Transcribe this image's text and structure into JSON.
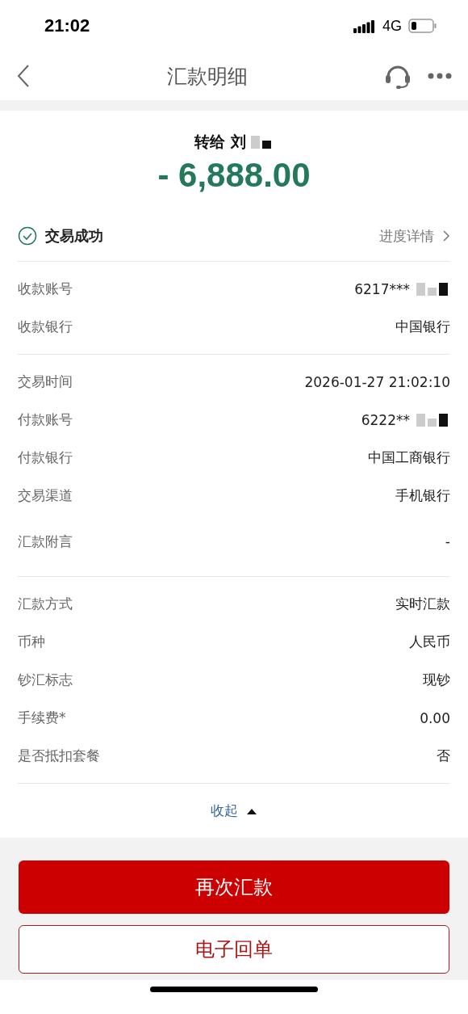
{
  "status_bar": {
    "time": "21:02",
    "network": "4G"
  },
  "nav": {
    "title": "汇款明细"
  },
  "summary": {
    "payee_prefix": "转给",
    "payee_name": "刘",
    "payee_masked": true,
    "amount": "- 6,888.00"
  },
  "status": {
    "label": "交易成功",
    "link": "进度详情"
  },
  "groups": [
    {
      "rows": [
        {
          "label": "收款账号",
          "value": "6217***",
          "masked": true
        },
        {
          "label": "收款银行",
          "value": "中国银行",
          "masked": false
        }
      ]
    },
    {
      "rows": [
        {
          "label": "交易时间",
          "value": "2026-01-27 21:02:10",
          "masked": false
        },
        {
          "label": "付款账号",
          "value": "6222**",
          "masked": true
        },
        {
          "label": "付款银行",
          "value": "中国工商银行",
          "masked": false
        },
        {
          "label": "交易渠道",
          "value": "手机银行",
          "masked": false
        },
        {
          "label": "汇款附言",
          "value": "-",
          "masked": false
        }
      ]
    },
    {
      "rows": [
        {
          "label": "汇款方式",
          "value": "实时汇款",
          "masked": false
        },
        {
          "label": "币种",
          "value": "人民币",
          "masked": false
        },
        {
          "label": "钞汇标志",
          "value": "现钞",
          "masked": false
        },
        {
          "label": "手续费*",
          "value": "0.00",
          "masked": false
        },
        {
          "label": "是否抵扣套餐",
          "value": "否",
          "masked": false
        }
      ]
    }
  ],
  "collapse": {
    "label": "收起",
    "expanded": true
  },
  "buttons": [
    {
      "label": "再次汇款",
      "kind": "primary"
    },
    {
      "label": "电子回单",
      "kind": "outline"
    }
  ]
}
